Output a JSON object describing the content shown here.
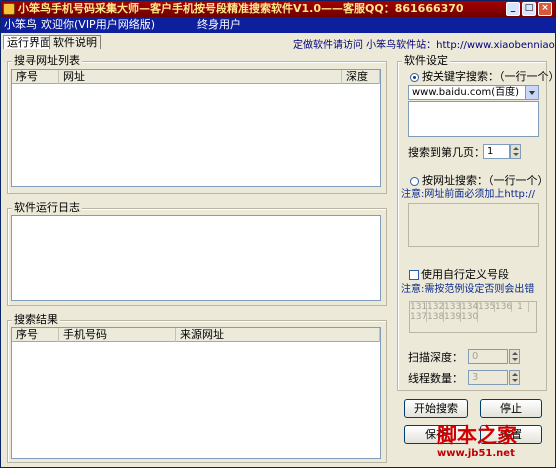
{
  "window": {
    "title": "小笨鸟手机号码采集大师—客户手机按号段精准搜索软件V1.0——客服QQ：861666370",
    "min_label": "_",
    "max_label": "□",
    "close_label": "×"
  },
  "menu": {
    "app_name": "小笨鸟",
    "welcome": "欢迎你(VIP用户网络版)",
    "lifetime": "终身用户"
  },
  "tabs": [
    {
      "label": "运行界面",
      "active": true
    },
    {
      "label": "软件说明",
      "active": false
    }
  ],
  "site_text": "定做软件请访问 小笨鸟软件站：http://www.xiaobenniao.com/",
  "search_list": {
    "title": "搜寻网址列表",
    "columns": [
      "序号",
      "网址",
      "深度"
    ]
  },
  "log": {
    "title": "软件运行日志"
  },
  "results": {
    "title": "搜索结果",
    "columns": [
      "序号",
      "手机号码",
      "来源网址"
    ]
  },
  "settings": {
    "title": "软件设定",
    "keyword_radio": "按关键字搜索：（一行一个）",
    "keyword_selected": true,
    "engine_value": "www.baidu.com(百度)",
    "pages_label": "搜索到第几页：",
    "pages_value": "1",
    "url_radio": "按网址搜索：（一行一个）",
    "url_note": "注意:网址前面必须加上http://",
    "custom_prefix_label": "使用自行定义号段",
    "custom_prefix_note": "注意:需按范例设定否则会出错",
    "prefixes_row1": [
      "131",
      "132",
      "133",
      "134",
      "135",
      "136",
      "1"
    ],
    "prefixes_row2": [
      "137",
      "138",
      "139",
      "130"
    ],
    "depth_label": "扫描深度：",
    "depth_value": "0",
    "threads_label": "线程数量：",
    "threads_value": "3"
  },
  "buttons": {
    "start": "开始搜索",
    "stop": "停止",
    "save": "保存",
    "settings": "设置"
  },
  "watermark": {
    "text": "脚本之家",
    "url": "www.jb51.net"
  }
}
